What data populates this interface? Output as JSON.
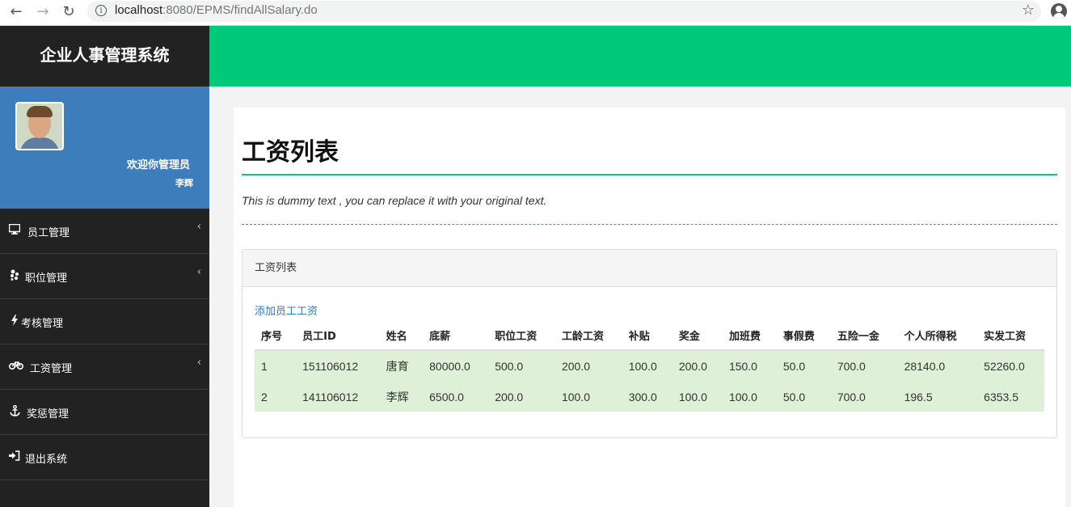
{
  "browser": {
    "url_host": "localhost",
    "url_rest": ":8080/EPMS/findAllSalary.do"
  },
  "sidebar": {
    "brand": "企业人事管理系统",
    "welcome": "欢迎你管理员",
    "user_name": "李辉",
    "items": [
      {
        "label": "员工管理",
        "icon": "monitor-icon",
        "has_submenu": true
      },
      {
        "label": "职位管理",
        "icon": "yelp-icon",
        "has_submenu": true
      },
      {
        "label": "考核管理",
        "icon": "bolt-icon",
        "has_submenu": false
      },
      {
        "label": "工资管理",
        "icon": "bicycle-icon",
        "has_submenu": true
      },
      {
        "label": "奖惩管理",
        "icon": "anchor-icon",
        "has_submenu": false
      },
      {
        "label": "退出系统",
        "icon": "sign-in-icon",
        "has_submenu": false
      }
    ]
  },
  "main": {
    "title": "工资列表",
    "subtitle": "This is dummy text , you can replace it with your original text.",
    "panel_title": "工资列表",
    "add_link": "添加员工工资",
    "columns": [
      "序号",
      "员工ID",
      "姓名",
      "底薪",
      "职位工资",
      "工龄工资",
      "补贴",
      "奖金",
      "加班费",
      "事假费",
      "五险一金",
      "个人所得税",
      "实发工资"
    ],
    "rows": [
      [
        "1",
        "151106012",
        "唐育",
        "80000.0",
        "500.0",
        "200.0",
        "100.0",
        "200.0",
        "150.0",
        "50.0",
        "700.0",
        "28140.0",
        "52260.0"
      ],
      [
        "2",
        "141106012",
        "李辉",
        "6500.0",
        "200.0",
        "100.0",
        "300.0",
        "100.0",
        "100.0",
        "50.0",
        "700.0",
        "196.5",
        "6353.5"
      ]
    ]
  },
  "colors": {
    "header_green": "#00ca79",
    "sidebar_dark": "#222222",
    "user_blue": "#3e7dbb",
    "row_green": "#dff0d8",
    "link_blue": "#337ab7"
  }
}
